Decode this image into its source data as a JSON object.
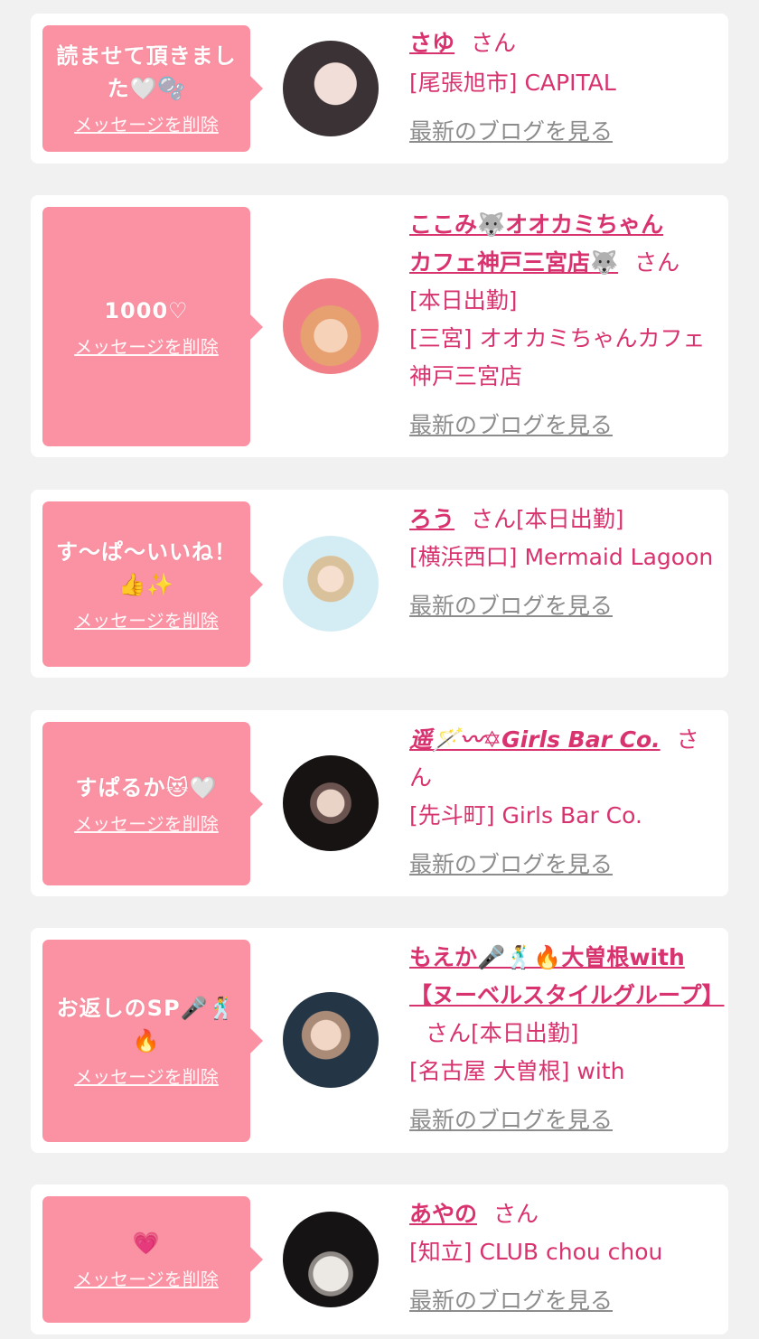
{
  "colors": {
    "background": "#f1f1f2",
    "card": "#ffffff",
    "bubble": "#fb92a3",
    "accent_text": "#d8336f",
    "muted_link": "#8c8c8c"
  },
  "common": {
    "delete_label": "メッセージを削除",
    "blog_label": "最新のブログを見る",
    "honorific": "さん"
  },
  "messages": [
    {
      "bubble_text": "読ませて頂きました🤍🫧",
      "name_line1": "さゆ",
      "name_line2": "",
      "status": "",
      "shop": "[尾張旭市] CAPITAL",
      "avatar_icon": "profile-photo"
    },
    {
      "bubble_text": "1000♡",
      "name_line1": "ここみ🐺オオカミちゃん",
      "name_line2": "カフェ神戸三宮店🐺",
      "status": "[本日出勤]",
      "shop": "[三宮] オオカミちゃんカフェ神戸三宮店",
      "avatar_icon": "profile-photo"
    },
    {
      "bubble_text": "す〜ぱ〜いいね！👍✨",
      "name_line1": "ろう",
      "name_line2": "",
      "status": "[本日出勤]",
      "shop": "[横浜西口] Mermaid Lagoon",
      "avatar_icon": "profile-photo"
    },
    {
      "bubble_text": "すぱるか😻🤍",
      "name_line1": "遥🪄〰✡Girls Bar Co.",
      "name_line2": "",
      "status": "",
      "shop": "[先斗町] Girls Bar Co.",
      "avatar_icon": "profile-photo"
    },
    {
      "bubble_text": "お返しのSP🎤🕺🔥",
      "name_line1": "もえか🎤🕺🔥大曽根with",
      "name_line2": "【ヌーベルスタイルグループ】",
      "status": "[本日出勤]",
      "shop": "[名古屋 大曽根] with",
      "avatar_icon": "profile-photo"
    },
    {
      "bubble_text": "💗",
      "name_line1": "あやの",
      "name_line2": "",
      "status": "",
      "shop": "[知立] CLUB chou chou",
      "avatar_icon": "profile-photo"
    }
  ]
}
